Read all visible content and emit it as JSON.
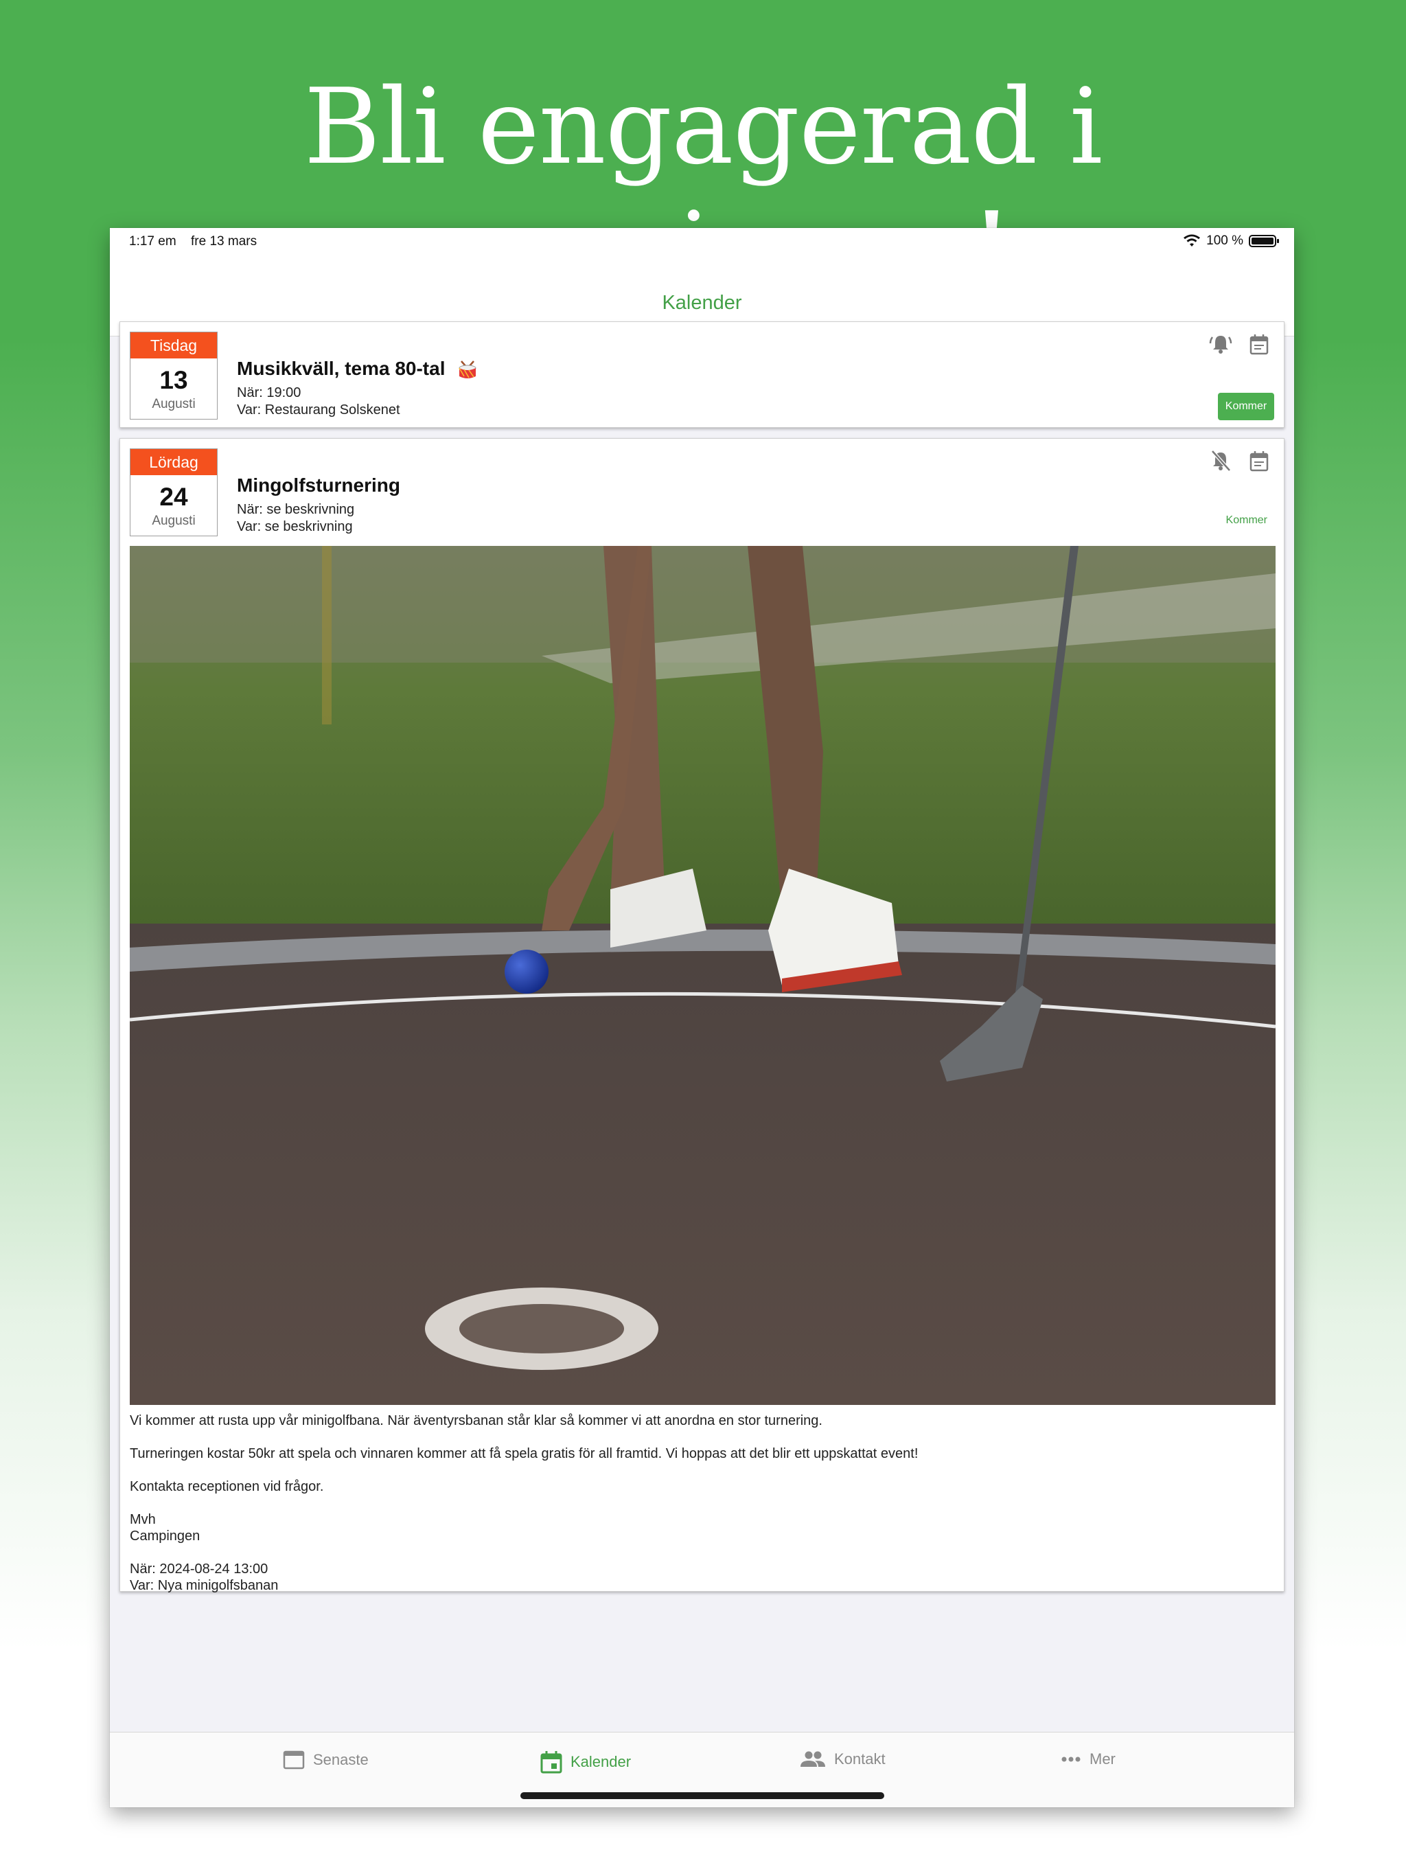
{
  "headline": "Bli engagerad i campingen!",
  "status_bar": {
    "time": "1:17 em",
    "date": "fre 13 mars",
    "battery": "100 %"
  },
  "navbar": {
    "title": "Kalender"
  },
  "events": [
    {
      "weekday": "Tisdag",
      "day": "13",
      "month": "Augusti",
      "title": "Musikkväll, tema 80-tal",
      "when": "När: 19:00",
      "where": "Var: Restaurang Solskenet",
      "attend_label": "Kommer"
    },
    {
      "weekday": "Lördag",
      "day": "24",
      "month": "Augusti",
      "title": "Mingolfsturnering",
      "when": "När: se beskrivning",
      "where": "Var: se beskrivning",
      "attend_label": "Kommer",
      "description": {
        "p1": "Vi kommer att rusta upp vår minigolfbana. När äventyrsbanan står klar så kommer vi att anordna en stor turnering.",
        "p2": "Turneringen kostar 50kr att spela och vinnaren kommer att få spela gratis för all framtid. Vi hoppas att det blir ett uppskattat event!",
        "p3": "Kontakta receptionen vid frågor.",
        "sign1": "Mvh",
        "sign2": "Campingen",
        "when_full": "När: 2024-08-24 13:00",
        "where_full": "Var: Nya minigolfsbanan"
      }
    }
  ],
  "tabs": [
    {
      "label": "Senaste",
      "icon": "window-icon"
    },
    {
      "label": "Kalender",
      "icon": "calendar-icon"
    },
    {
      "label": "Kontakt",
      "icon": "people-icon"
    },
    {
      "label": "Mer",
      "icon": "more-icon"
    }
  ],
  "colors": {
    "brand": "#43a047",
    "date_header": "#f4511e",
    "background": "#4caf50"
  }
}
